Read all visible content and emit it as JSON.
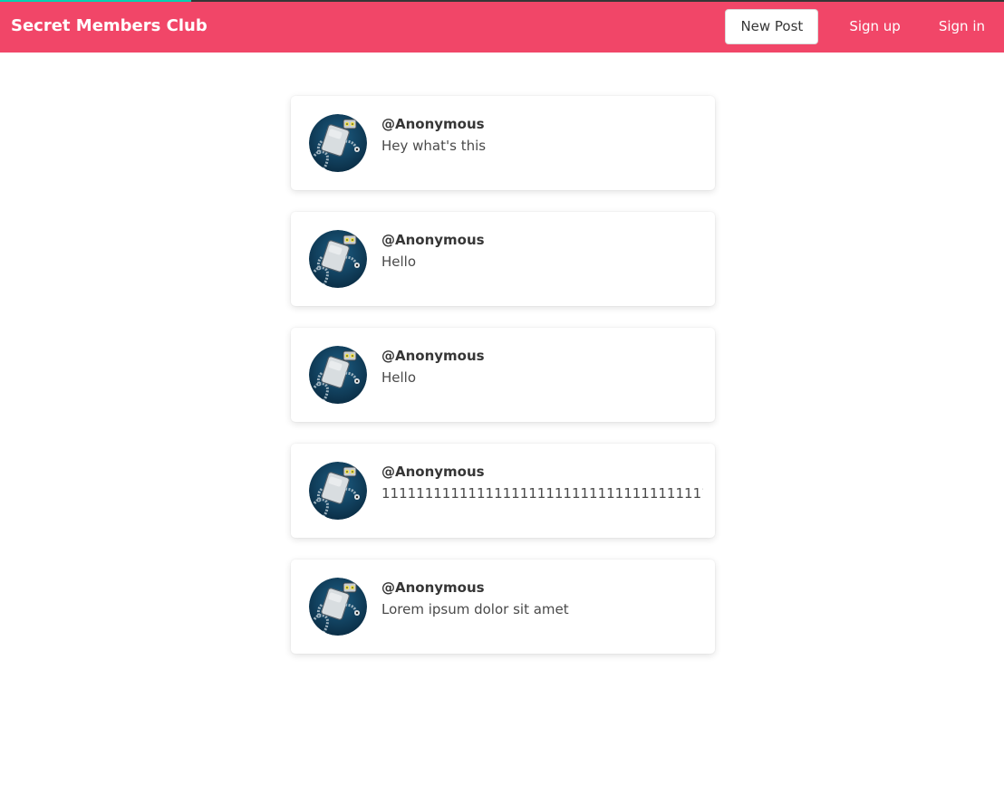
{
  "navbar": {
    "brand": "Secret Members Club",
    "new_post_label": "New Post",
    "sign_up_label": "Sign up",
    "sign_in_label": "Sign in",
    "background_color": "#f14668",
    "progress_color": "#00d1b2",
    "progress": 0.19
  },
  "posts": [
    {
      "author": "@Anonymous",
      "body": "Hey what's this",
      "avatar_icon": "robot-avatar-icon"
    },
    {
      "author": "@Anonymous",
      "body": "Hello",
      "avatar_icon": "robot-avatar-icon"
    },
    {
      "author": "@Anonymous",
      "body": "Hello",
      "avatar_icon": "robot-avatar-icon"
    },
    {
      "author": "@Anonymous",
      "body": "1111111111111111111111111111111111111111111",
      "avatar_icon": "robot-avatar-icon"
    },
    {
      "author": "@Anonymous",
      "body": "Lorem ipsum dolor sit amet",
      "avatar_icon": "robot-avatar-icon"
    }
  ]
}
